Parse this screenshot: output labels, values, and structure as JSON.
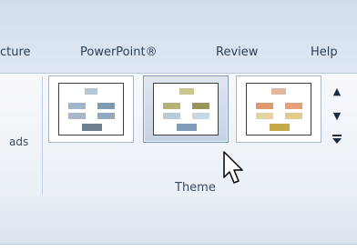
{
  "tabs": [
    {
      "label": "cture"
    },
    {
      "label": "PowerPoint®"
    },
    {
      "label": "Review"
    },
    {
      "label": "Help"
    }
  ],
  "ribbon": {
    "previous_group_label": "ads",
    "theme_group_label": "Theme",
    "gallery": [
      {
        "name": "blue-theme",
        "selected": false,
        "colors": {
          "top": "#b8c7d6",
          "mid": "#7f9bb3",
          "low": "#a8b7c6",
          "bottom": "#6f7f8f"
        }
      },
      {
        "name": "olive-theme",
        "selected": true,
        "colors": {
          "top": "#c9c68e",
          "mid": "#97965a",
          "low": "#b9cbd8",
          "bottom": "#7f9cbb"
        }
      },
      {
        "name": "warm-theme",
        "selected": false,
        "colors": {
          "top": "#e0b8a2",
          "mid": "#dd9870",
          "low": "#e4d3a4",
          "bottom": "#c5a94a"
        }
      }
    ],
    "scroll_icons": [
      "scroll-up-icon",
      "scroll-down-icon",
      "more-icon"
    ]
  }
}
